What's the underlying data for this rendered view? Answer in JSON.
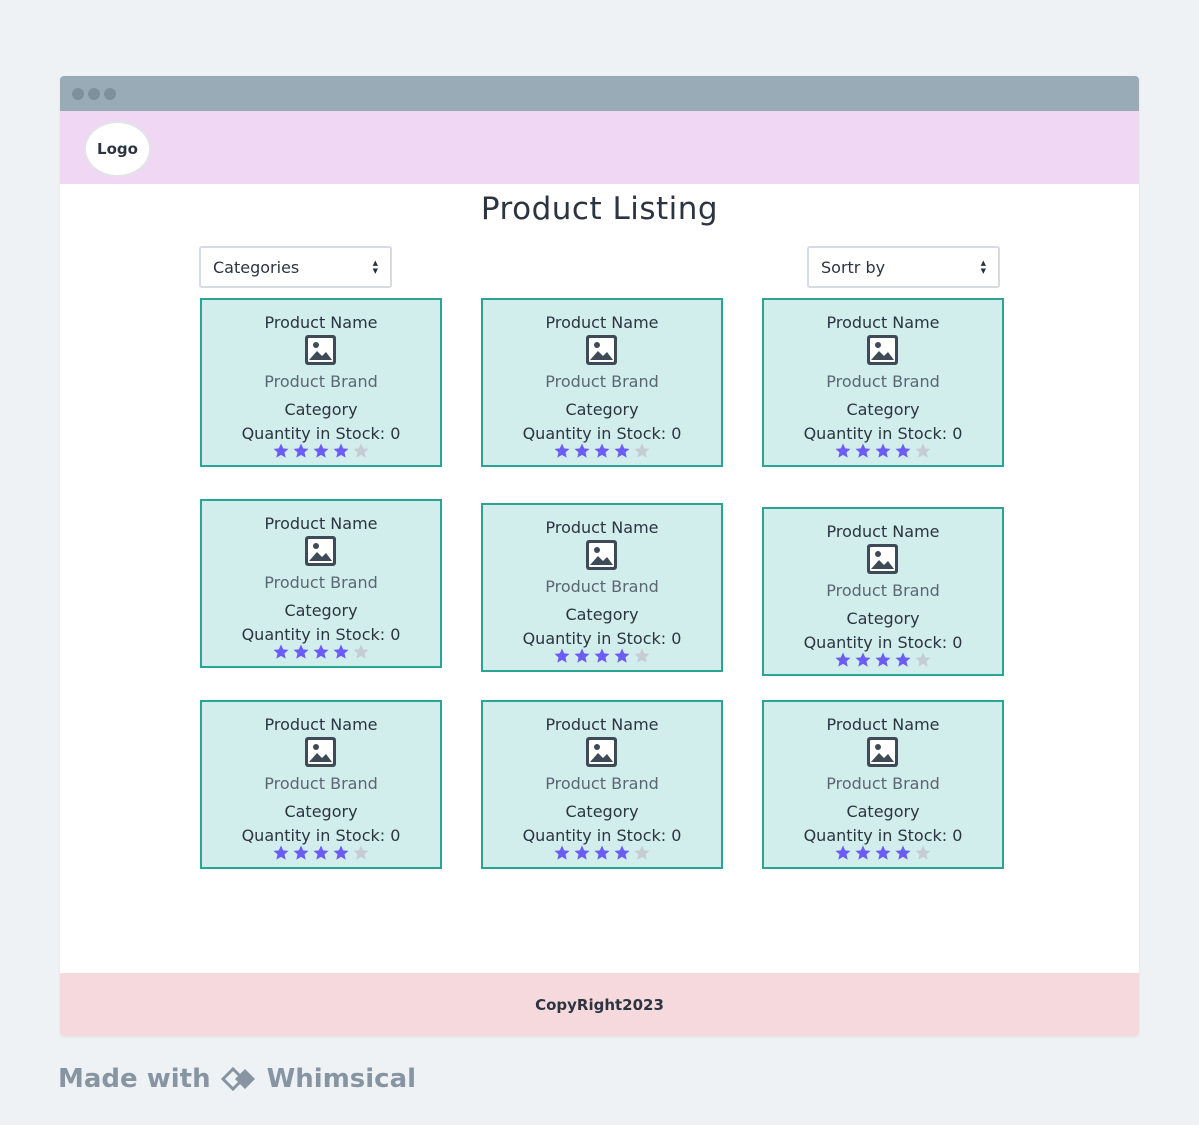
{
  "header": {
    "logo_label": "Logo"
  },
  "page": {
    "title": "Product Listing"
  },
  "filters": {
    "categories_label": "Categories",
    "sort_label": "Sortr by"
  },
  "products": [
    {
      "name": "Product Name",
      "brand": "Product Brand",
      "category": "Category",
      "quantity": "Quantity in Stock: 0",
      "rating": 4,
      "rating_max": 5
    },
    {
      "name": "Product Name",
      "brand": "Product Brand",
      "category": "Category",
      "quantity": "Quantity in Stock: 0",
      "rating": 4,
      "rating_max": 5
    },
    {
      "name": "Product Name",
      "brand": "Product Brand",
      "category": "Category",
      "quantity": "Quantity in Stock: 0",
      "rating": 4,
      "rating_max": 5
    },
    {
      "name": "Product Name",
      "brand": "Product Brand",
      "category": "Category",
      "quantity": "Quantity in Stock: 0",
      "rating": 4,
      "rating_max": 5
    },
    {
      "name": "Product Name",
      "brand": "Product Brand",
      "category": "Category",
      "quantity": "Quantity in Stock: 0",
      "rating": 4,
      "rating_max": 5
    },
    {
      "name": "Product Name",
      "brand": "Product Brand",
      "category": "Category",
      "quantity": "Quantity in Stock: 0",
      "rating": 4,
      "rating_max": 5
    },
    {
      "name": "Product Name",
      "brand": "Product Brand",
      "category": "Category",
      "quantity": "Quantity in Stock: 0",
      "rating": 4,
      "rating_max": 5
    },
    {
      "name": "Product Name",
      "brand": "Product Brand",
      "category": "Category",
      "quantity": "Quantity in Stock: 0",
      "rating": 4,
      "rating_max": 5
    },
    {
      "name": "Product Name",
      "brand": "Product Brand",
      "category": "Category",
      "quantity": "Quantity in Stock: 0",
      "rating": 4,
      "rating_max": 5
    }
  ],
  "footer": {
    "copyright": "CopyRight2023"
  },
  "watermark": {
    "made_with": "Made with",
    "brand": "Whimsical"
  },
  "colors": {
    "header_bg": "#f0d7f3",
    "footer_bg": "#f5d9dd",
    "card_bg": "#d1eeec",
    "card_border": "#2aa593",
    "star_filled": "#6b5cf5",
    "star_empty": "#c5ccd3"
  },
  "icons": {
    "product_image": "image-icon",
    "star": "star-icon",
    "select_arrows": "sort-arrows-icon"
  }
}
